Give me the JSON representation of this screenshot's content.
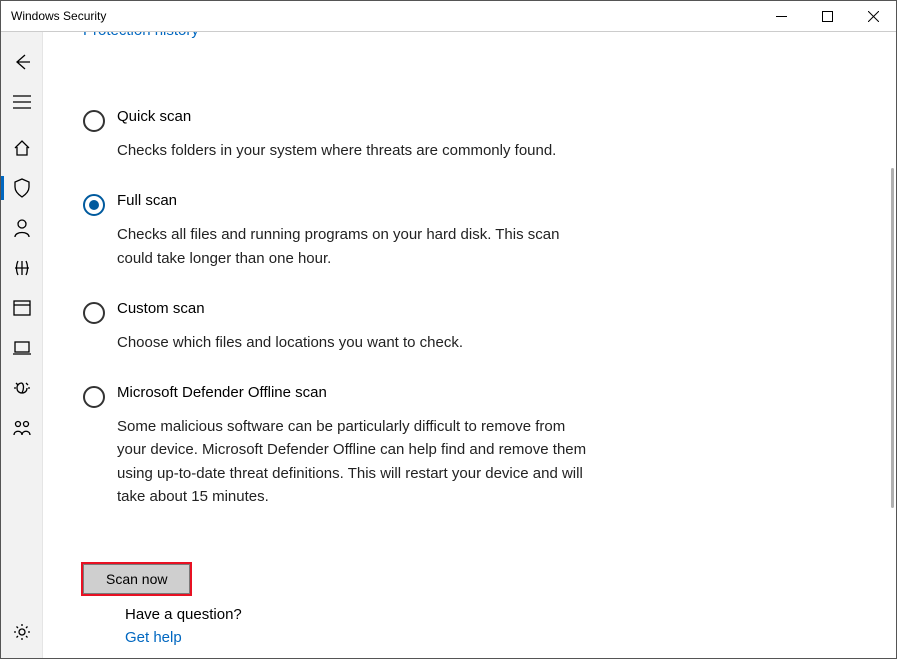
{
  "window": {
    "title": "Windows Security"
  },
  "topLink": "Protection history",
  "options": [
    {
      "label": "Quick scan",
      "desc": "Checks folders in your system where threats are commonly found.",
      "selected": false
    },
    {
      "label": "Full scan",
      "desc": "Checks all files and running programs on your hard disk. This scan could take longer than one hour.",
      "selected": true
    },
    {
      "label": "Custom scan",
      "desc": "Choose which files and locations you want to check.",
      "selected": false
    },
    {
      "label": "Microsoft Defender Offline scan",
      "desc": "Some malicious software can be particularly difficult to remove from your device. Microsoft Defender Offline can help find and remove them using up-to-date threat definitions. This will restart your device and will take about 15 minutes.",
      "selected": false
    }
  ],
  "scanButton": "Scan now",
  "question": {
    "heading": "Have a question?",
    "link": "Get help"
  }
}
